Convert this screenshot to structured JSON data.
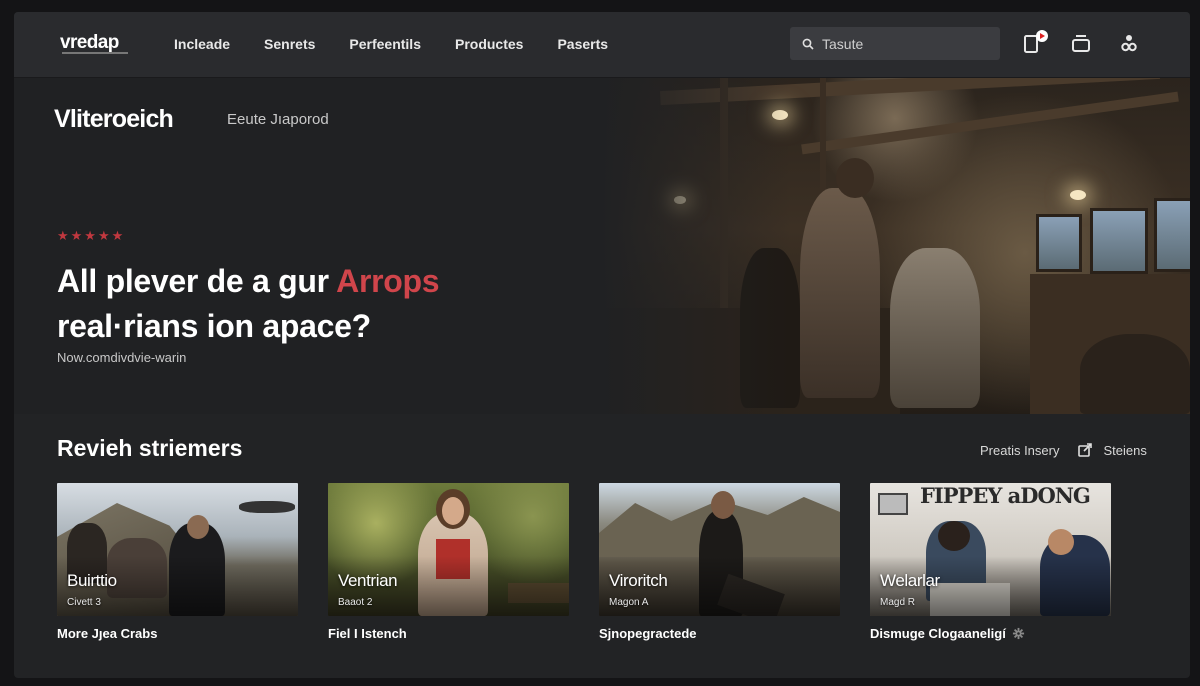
{
  "header": {
    "logo": "vredap",
    "nav": [
      "Incleade",
      "Senrets",
      "Perfeentils",
      "Productes",
      "Paserts"
    ],
    "search": {
      "placeholder": "Tasute",
      "icon": "search-icon"
    },
    "icons": [
      "video-notification-icon",
      "window-icon",
      "user-icon"
    ]
  },
  "hero": {
    "brand": "Vliteroeich",
    "brand_tag": "Eeute Jıaporod",
    "stars": "★★★★★",
    "rating_stars": 5,
    "headline_pre": "All plever de a gur ",
    "headline_accent": "Arrops",
    "headline_line2": "real·rians ion apace?",
    "subtext": "Now.comdivdvie-warin"
  },
  "reviews": {
    "title": "Revieh striemers",
    "link_label": "Preatis Insery",
    "share_label": "Steiens",
    "cards": [
      {
        "thumb_title": "Buirttio",
        "thumb_sub": "Civett 3",
        "caption": "More Jȷea Crabs"
      },
      {
        "thumb_title": "Ventrian",
        "thumb_sub": "Baaot 2",
        "caption": "Fiel I Istench"
      },
      {
        "thumb_title": "Viroritch",
        "thumb_sub": "Magon A",
        "caption": "Sjnopegractede"
      },
      {
        "thumb_title": "Welarlar",
        "thumb_sub": "Magd R",
        "caption": "Dismuge Clogaaneligí",
        "sign_text": "FIPPEY aDONG",
        "caption_icon": "gear-icon"
      }
    ]
  },
  "colors": {
    "accent": "#d0454b",
    "stars": "#c1383f",
    "background": "#222325",
    "topbar": "#2a2b2e"
  }
}
